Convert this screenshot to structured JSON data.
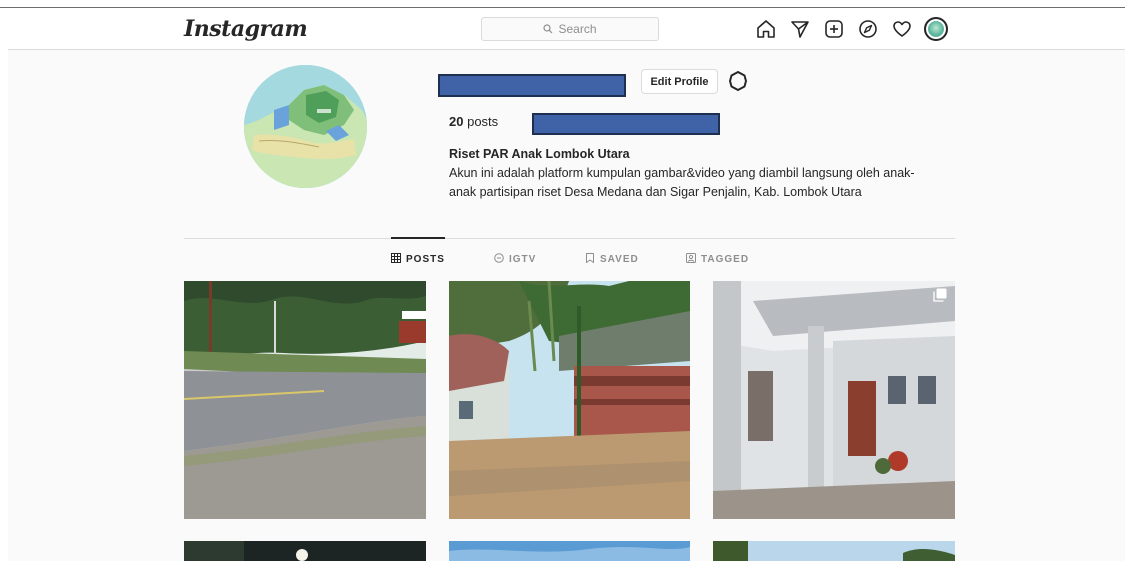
{
  "header": {
    "logo": "Instagram",
    "search_placeholder": "Search",
    "nav_icons": [
      "home-icon",
      "direct-icon",
      "new-post-icon",
      "explore-icon",
      "activity-icon",
      "profile-avatar"
    ]
  },
  "profile": {
    "edit_profile_label": "Edit Profile",
    "posts_count": "20",
    "posts_label": "posts",
    "full_name": "Riset PAR Anak Lombok Utara",
    "bio_line1": "Akun ini adalah platform kumpulan gambar&video yang diambil langsung oleh anak-",
    "bio_line2": "anak partisipan riset Desa Medana dan Sigar Penjalin, Kab. Lombok Utara"
  },
  "tabs": [
    {
      "label": "POSTS",
      "active": true
    },
    {
      "label": "IGTV",
      "active": false
    },
    {
      "label": "SAVED",
      "active": false
    },
    {
      "label": "TAGGED",
      "active": false
    }
  ],
  "colors": {
    "redaction": "#3f63a6",
    "text": "#262626",
    "muted": "#8e8e8e",
    "border": "#dbdbdb"
  }
}
